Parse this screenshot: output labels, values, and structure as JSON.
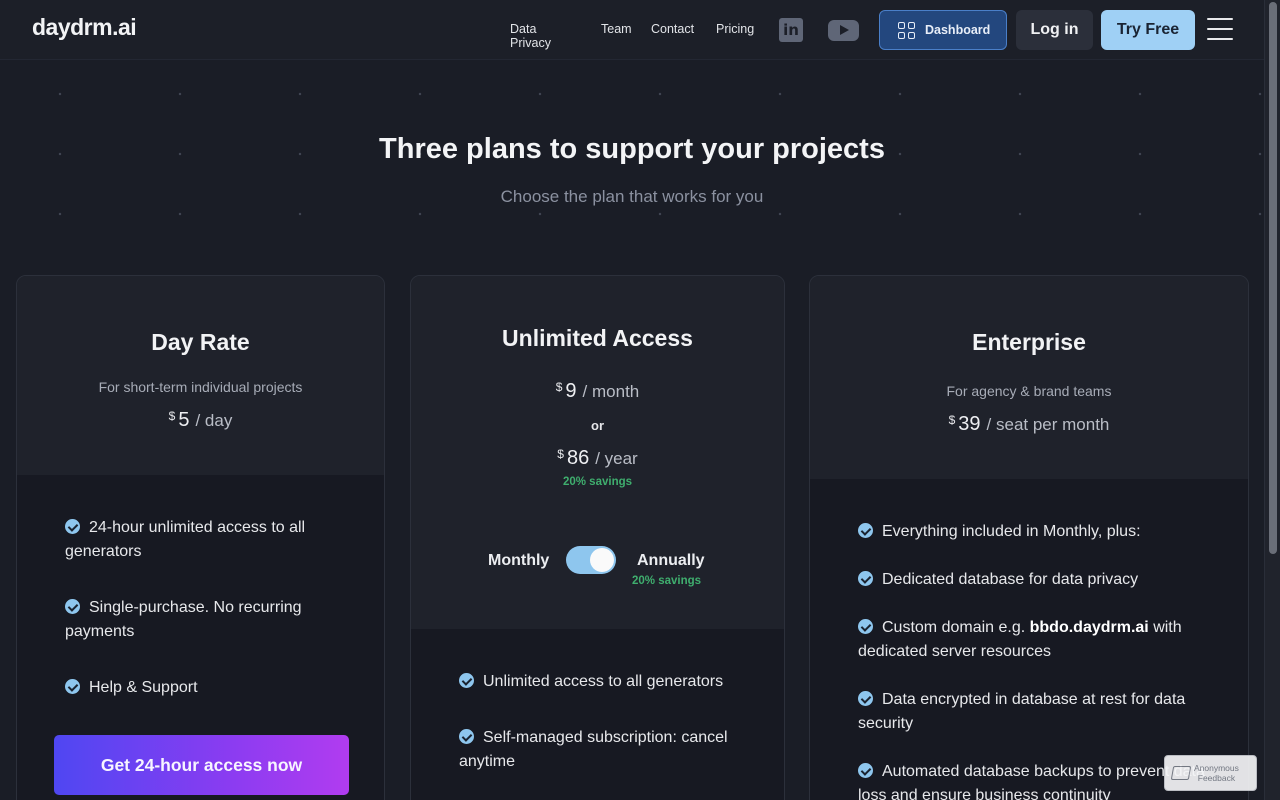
{
  "header": {
    "logo": "daydrm.ai",
    "nav": [
      "Data Privacy",
      "Team",
      "Contact",
      "Pricing"
    ],
    "social": [
      "linkedin-icon",
      "youtube-icon"
    ],
    "dashboard_label": "Dashboard",
    "login_label": "Log in",
    "try_label": "Try Free"
  },
  "hero": {
    "title": "Three plans to support your projects",
    "subtitle": "Choose the plan that works for you"
  },
  "plans": [
    {
      "title": "Day Rate",
      "description": "For short-term individual projects",
      "currency": "$",
      "amount": "5",
      "period": "/ day",
      "features": [
        "24-hour unlimited access to all generators",
        "Single-purchase. No recurring payments",
        "Help & Support"
      ],
      "cta": "Get 24-hour access now"
    },
    {
      "title": "Unlimited Access",
      "currency": "$",
      "monthly_amount": "9",
      "monthly_period": "/ month",
      "or": "or",
      "yearly_amount": "86",
      "yearly_period": "/ year",
      "savings": "20% savings",
      "toggle": {
        "left_label": "Monthly",
        "right_label": "Annually",
        "right_savings": "20% savings",
        "selected": "Annually"
      },
      "features": [
        "Unlimited access to all generators",
        "Self-managed subscription: cancel anytime"
      ]
    },
    {
      "title": "Enterprise",
      "description": "For agency & brand teams",
      "currency": "$",
      "amount": "39",
      "period": "/ seat per month",
      "features": [
        "Everything included in Monthly, plus:",
        "Dedicated database for data privacy",
        {
          "prefix": "Custom domain e.g. ",
          "bold": "bbdo.daydrm.ai",
          "suffix": " with dedicated server resources"
        },
        "Data encrypted in database at rest for data security",
        "Automated database backups to prevent data loss and ensure business continuity"
      ]
    }
  ],
  "feedback": {
    "line1": "Anonymous",
    "line2": "Feedback"
  },
  "colors": {
    "background": "#1a1d26",
    "accent": "#9fd0f5",
    "savings": "#3fae6e",
    "cta_start": "#4f47f2",
    "cta_end": "#b13cf0"
  }
}
